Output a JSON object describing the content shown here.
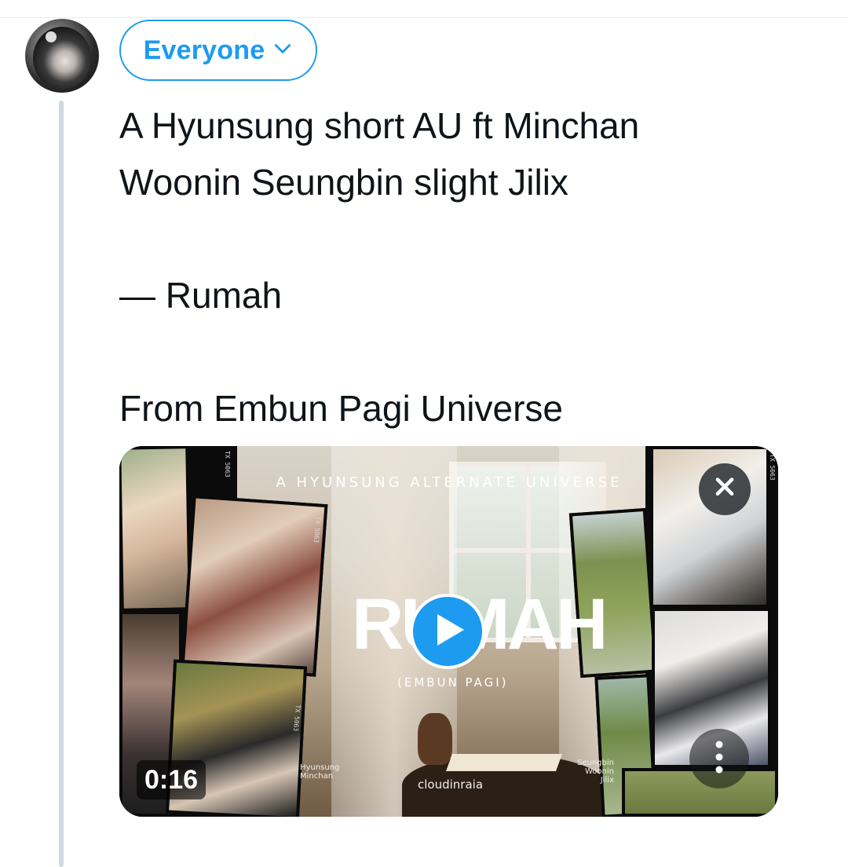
{
  "audience": {
    "label": "Everyone"
  },
  "tweet": {
    "line1": "A Hyunsung short AU ft Minchan",
    "line2": "Woonin Seungbin slight Jilix",
    "line3": "— Rumah",
    "line4": "From Embun Pagi Universe"
  },
  "media": {
    "overlay_title": "A HYUNSUNG ALTERNATE UNIVERSE",
    "big_title": "RUMAH",
    "sub_title": "(EMBUN PAGI)",
    "watermark": "cloudinraia",
    "caption_left": [
      "Hyunsung",
      "Minchan"
    ],
    "caption_right": [
      "Seungbin",
      "Woonin",
      "Jilix"
    ],
    "film_code": "TX 5063",
    "duration": "0:16"
  },
  "icons": {
    "audience_chevron": "chevron-down-icon",
    "play": "play-icon",
    "close": "close-icon",
    "more": "more-vertical-icon"
  },
  "colors": {
    "accent": "#1d9bf0",
    "text": "#0f1419",
    "thread_line": "#cfd9de"
  }
}
